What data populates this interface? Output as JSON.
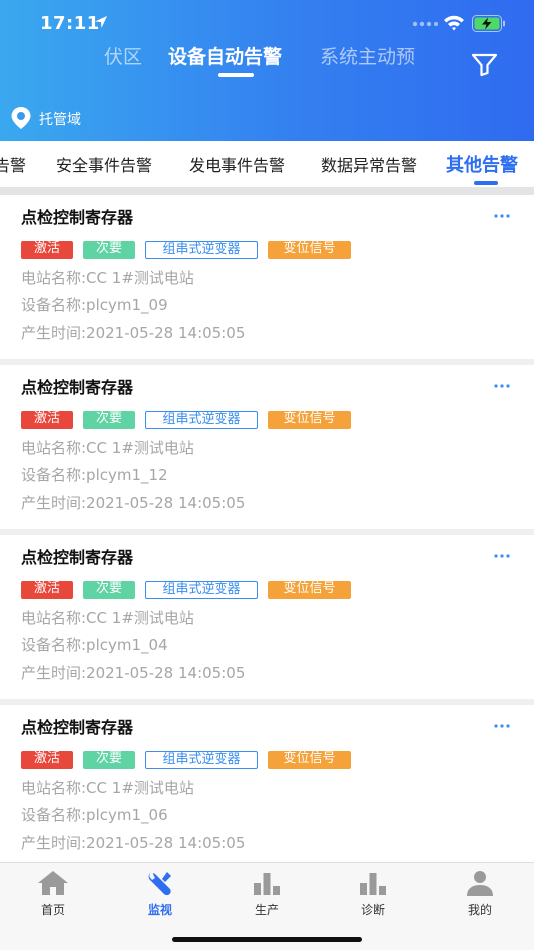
{
  "status": {
    "time": "17:11"
  },
  "header": {
    "tabs": [
      {
        "label": "伏区"
      },
      {
        "label": "设备自动告警"
      },
      {
        "label": "系统主动预"
      }
    ],
    "domain": "托管域"
  },
  "categories": [
    {
      "label": "告警"
    },
    {
      "label": "安全事件告警"
    },
    {
      "label": "发电事件告警"
    },
    {
      "label": "数据异常告警"
    },
    {
      "label": "其他告警"
    }
  ],
  "alarms": [
    {
      "title": "点检控制寄存器",
      "tags": {
        "status": "激活",
        "level": "次要",
        "device_type": "组串式逆变器",
        "type": "变位信号"
      },
      "station": "电站名称:CC 1#测试电站",
      "device": "设备名称:plcym1_09",
      "time": "产生时间:2021-05-28 14:05:05"
    },
    {
      "title": "点检控制寄存器",
      "tags": {
        "status": "激活",
        "level": "次要",
        "device_type": "组串式逆变器",
        "type": "变位信号"
      },
      "station": "电站名称:CC 1#测试电站",
      "device": "设备名称:plcym1_12",
      "time": "产生时间:2021-05-28 14:05:05"
    },
    {
      "title": "点检控制寄存器",
      "tags": {
        "status": "激活",
        "level": "次要",
        "device_type": "组串式逆变器",
        "type": "变位信号"
      },
      "station": "电站名称:CC 1#测试电站",
      "device": "设备名称:plcym1_04",
      "time": "产生时间:2021-05-28 14:05:05"
    },
    {
      "title": "点检控制寄存器",
      "tags": {
        "status": "激活",
        "level": "次要",
        "device_type": "组串式逆变器",
        "type": "变位信号"
      },
      "station": "电站名称:CC 1#测试电站",
      "device": "设备名称:plcym1_06",
      "time": "产生时间:2021-05-28 14:05:05"
    }
  ],
  "nav": [
    {
      "label": "首页",
      "icon": "home-icon"
    },
    {
      "label": "监视",
      "icon": "wrench-icon"
    },
    {
      "label": "生产",
      "icon": "bar-chart-icon"
    },
    {
      "label": "诊断",
      "icon": "bar-chart-icon"
    },
    {
      "label": "我的",
      "icon": "user-icon"
    }
  ],
  "colors": {
    "header_start": "#3aa8ef",
    "header_end": "#2f6bf0",
    "accent": "#2f6ef0",
    "badge_active": "#e8473c",
    "badge_minor": "#5fd3a3",
    "badge_device": "#3a8ef0",
    "badge_signal": "#f5a23a"
  }
}
